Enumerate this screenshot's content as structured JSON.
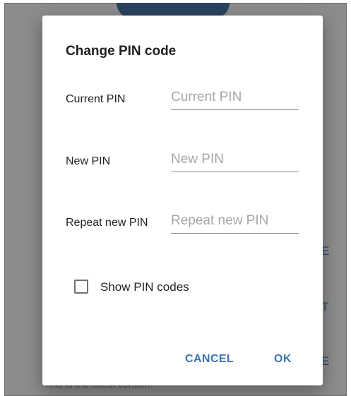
{
  "background": {
    "actions": [
      "E",
      "T",
      "E"
    ],
    "footer_text": "This is the latest version."
  },
  "dialog": {
    "title": "Change PIN code",
    "fields": [
      {
        "label": "Current PIN",
        "placeholder": "Current PIN",
        "value": ""
      },
      {
        "label": "New PIN",
        "placeholder": "New PIN",
        "value": ""
      },
      {
        "label": "Repeat new PIN",
        "placeholder": "Repeat new PIN",
        "value": ""
      }
    ],
    "show_pin_label": "Show PIN codes",
    "show_pin_checked": false,
    "cancel_label": "CANCEL",
    "ok_label": "OK"
  },
  "colors": {
    "accent": "#3b73ad",
    "scrim": "rgba(0,0,0,0.45)",
    "header_blue": "#4d79ad"
  }
}
